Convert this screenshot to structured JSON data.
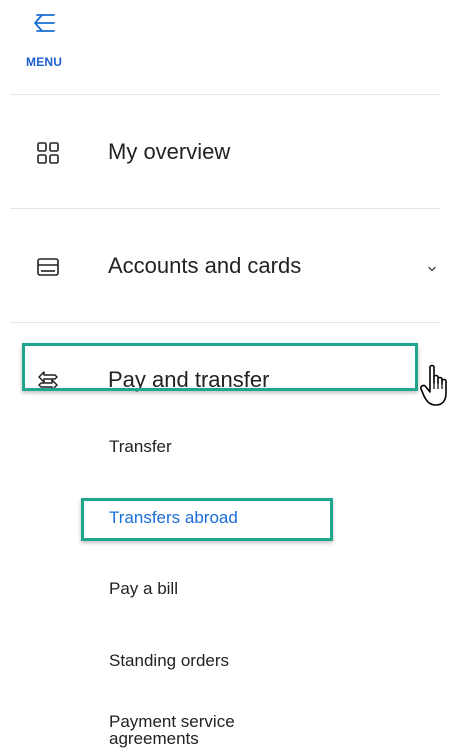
{
  "menu": {
    "label": "MENU",
    "icon": "back-arrow-icon"
  },
  "nav": {
    "items": [
      {
        "label": "My overview",
        "icon": "grid-icon"
      },
      {
        "label": "Accounts and cards",
        "icon": "card-icon",
        "has_chevron": true
      },
      {
        "label": "Pay and transfer",
        "icon": "transfer-icon",
        "highlighted": true
      }
    ]
  },
  "submenu": {
    "items": [
      {
        "label": "Transfer"
      },
      {
        "label": "Transfers abroad",
        "active": true,
        "highlighted": true
      },
      {
        "label": "Pay a bill"
      },
      {
        "label": "Standing orders"
      },
      {
        "label_line1": "Payment service",
        "label_line2": "agreements"
      }
    ]
  },
  "colors": {
    "accent": "#1a6ed8",
    "highlight": "#21a58c",
    "text": "#222222",
    "divider": "#e6e6e6"
  }
}
